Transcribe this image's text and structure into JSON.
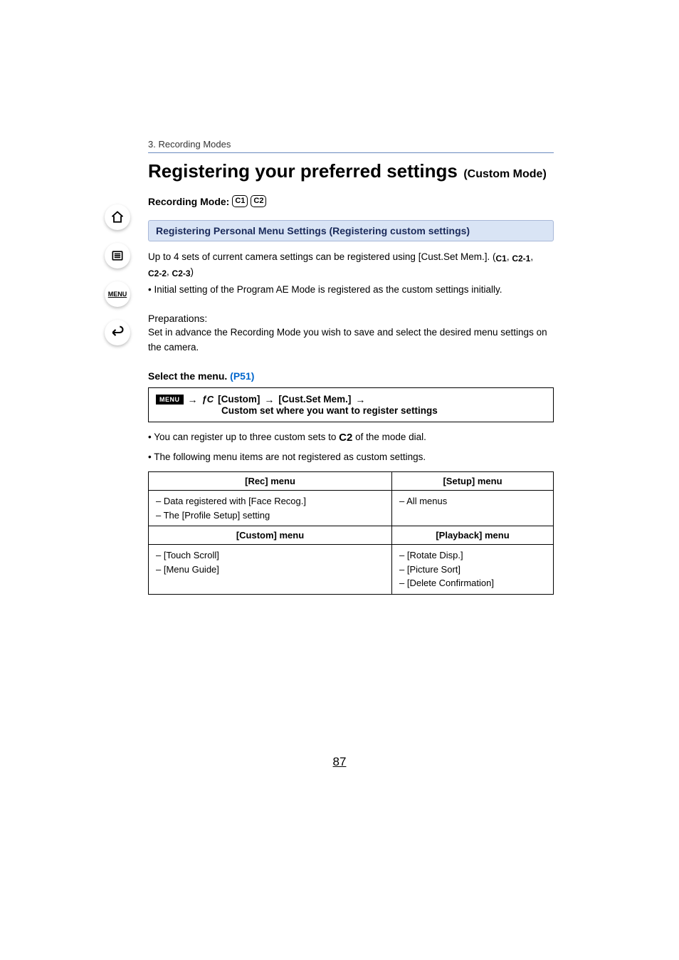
{
  "breadcrumb": "3. Recording Modes",
  "titleMain": "Registering your preferred settings",
  "titleSub": "(Custom Mode)",
  "recModeLabel": "Recording Mode:",
  "recModeBadges": [
    "C1",
    "C2"
  ],
  "sectionHeader": "Registering Personal Menu Settings (Registering custom settings)",
  "intro1a": "Up to 4 sets of current camera settings can be registered using [Cust.Set Mem.]. (",
  "customSetIcons": [
    "C1",
    "C2-1",
    "C2-2",
    "C2-3"
  ],
  "intro1b": ")",
  "intro2": "• Initial setting of the Program AE Mode is registered as the custom settings initially.",
  "prepLabel": "Preparations:",
  "prepText": "Set in advance the Recording Mode you wish to save and select the desired menu settings on the camera.",
  "selectMenuLabel": "Select the menu.",
  "selectMenuRef": "(P51)",
  "menuPath": {
    "badge": "MENU",
    "arrow": "→",
    "fcIcon": "ƒC",
    "p1": "[Custom]",
    "p2": "[Cust.Set Mem.]",
    "line2": "Custom set where you want to register settings"
  },
  "bullet1a": "• You can register up to three custom sets to ",
  "bullet1Icon": "C2",
  "bullet1b": " of the mode dial.",
  "bullet2": "• The following menu items are not registered as custom settings.",
  "table": {
    "headers1": [
      "[Rec] menu",
      "[Setup] menu"
    ],
    "row1": [
      [
        "– Data registered with [Face Recog.]",
        "– The [Profile Setup] setting"
      ],
      [
        "– All menus"
      ]
    ],
    "headers2": [
      "[Custom] menu",
      "[Playback] menu"
    ],
    "row2": [
      [
        "– [Touch Scroll]",
        "– [Menu Guide]"
      ],
      [
        "– [Rotate Disp.]",
        "– [Picture Sort]",
        "– [Delete Confirmation]"
      ]
    ]
  },
  "pageNumber": "87",
  "sideIcons": [
    "home-icon",
    "toc-icon",
    "menu-icon",
    "back-icon"
  ]
}
